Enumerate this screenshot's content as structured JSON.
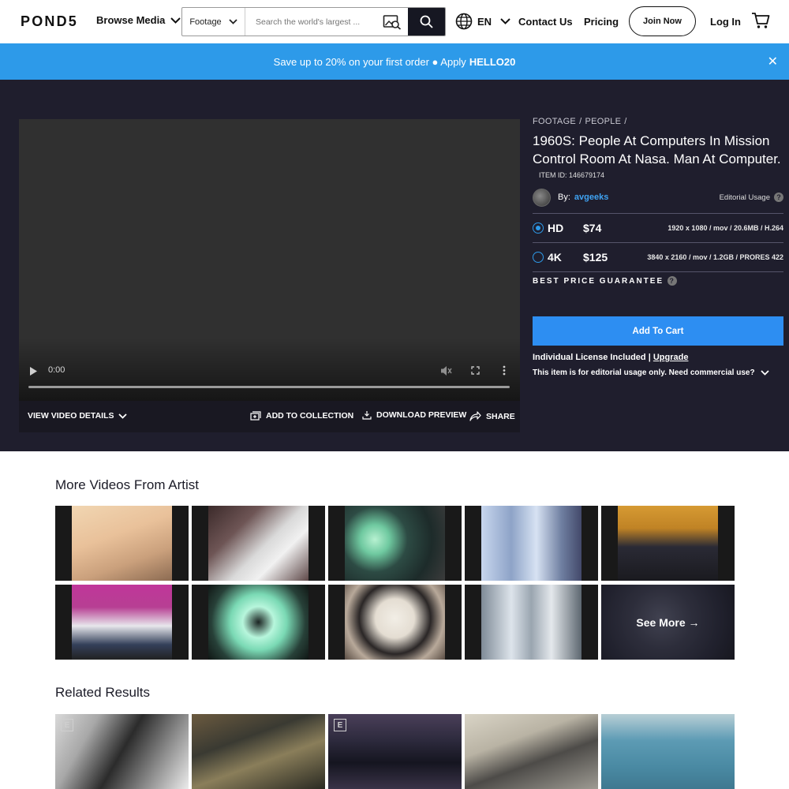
{
  "nav": {
    "logo": "POND5",
    "browse_label": "Browse Media",
    "search": {
      "type": "Footage",
      "placeholder": "Search the world's largest ..."
    },
    "language": "EN",
    "contact": "Contact Us",
    "pricing": "Pricing",
    "join": "Join Now",
    "login": "Log In"
  },
  "promo": {
    "text": "Save up to 20% on your first order ● Apply",
    "code": "HELLO20",
    "close": "✕"
  },
  "player": {
    "time": "0:00",
    "progress": 0
  },
  "player_bar": {
    "details": "VIEW VIDEO DETAILS",
    "collection": "ADD TO COLLECTION",
    "download": "DOWNLOAD PREVIEW",
    "share": "SHARE"
  },
  "item": {
    "breadcrumbs": [
      "FOOTAGE",
      "/",
      "PEOPLE",
      "/"
    ],
    "title": "1960S: People At Computers In Mission Control Room At Nasa. Man At Computer.",
    "item_id": "ITEM ID: 146679174",
    "by_label": "By:",
    "author": "avgeeks",
    "usage": "Editorial Usage",
    "options": [
      {
        "res": "HD",
        "price": "$74",
        "spec": "1920 x 1080 / mov / 20.6MB / H.264",
        "selected": true
      },
      {
        "res": "4K",
        "price": "$125",
        "spec": "3840 x 2160 / mov / 1.2GB / PRORES 422",
        "selected": false
      }
    ],
    "best_price": "BEST PRICE GUARANTEE",
    "add_to_cart": "Add To Cart",
    "license_text": "Individual License Included |",
    "upgrade": "Upgrade",
    "editorial_note": "This item is for editorial usage only. Need commercial use?"
  },
  "more_videos": {
    "title": "More Videos From Artist",
    "see_more": "See More →"
  },
  "related": {
    "title": "Related Results"
  }
}
